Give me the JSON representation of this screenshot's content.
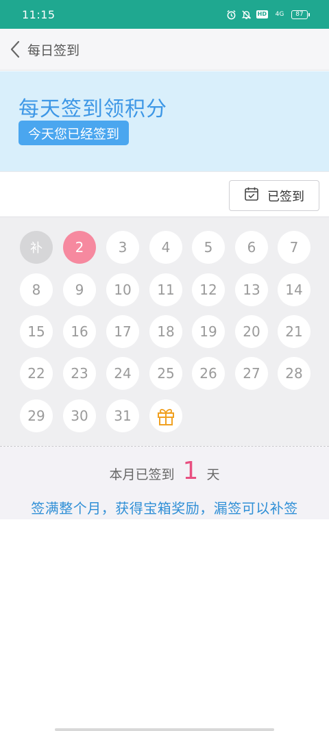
{
  "status_bar": {
    "time": "11:15",
    "network": "4G",
    "hd": "HD",
    "battery": "87",
    "icons": [
      "alarm-icon",
      "mute-icon",
      "hd-icon",
      "signal-icon",
      "battery-icon"
    ]
  },
  "app_bar": {
    "title": "每日签到"
  },
  "banner": {
    "title": "每天签到领积分",
    "badge": "今天您已经签到"
  },
  "action": {
    "signed_label": "已签到"
  },
  "calendar": {
    "makeup_label": "补",
    "days": [
      "2",
      "3",
      "4",
      "5",
      "6",
      "7",
      "8",
      "9",
      "10",
      "11",
      "12",
      "13",
      "14",
      "15",
      "16",
      "17",
      "18",
      "19",
      "20",
      "21",
      "22",
      "23",
      "24",
      "25",
      "26",
      "27",
      "28",
      "29",
      "30",
      "31"
    ],
    "signed_days": [
      "2"
    ],
    "gift_icon": "gift-icon"
  },
  "summary": {
    "prefix": "本月已签到",
    "count": "1",
    "suffix": "天",
    "note": "签满整个月，获得宝箱奖励，漏签可以补签"
  },
  "colors": {
    "status_bar": "#1fa890",
    "accent_blue": "#3d97e6",
    "signed_pink": "#f6899f",
    "count_pink": "#e84f80",
    "gift_orange": "#f0a020"
  }
}
